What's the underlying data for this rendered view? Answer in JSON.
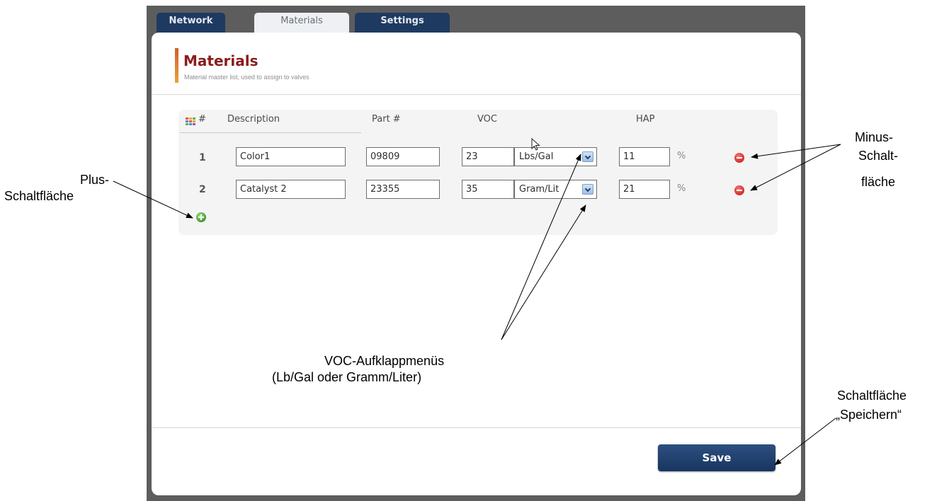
{
  "tabs": [
    {
      "label": "Network",
      "active": false
    },
    {
      "label": "Materials",
      "active": true
    },
    {
      "label": "Settings",
      "active": false
    }
  ],
  "page": {
    "title": "Materials",
    "subtitle": "Material master list, used to assign to valves"
  },
  "table": {
    "headers": {
      "number": "#",
      "description": "Description",
      "part": "Part #",
      "voc": "VOC",
      "hap": "HAP"
    },
    "rows": [
      {
        "num": "1",
        "description": "Color1",
        "part": "09809",
        "voc": "23",
        "voc_unit": "Lbs/Gal",
        "hap": "11",
        "hap_unit": "%"
      },
      {
        "num": "2",
        "description": "Catalyst 2",
        "part": "23355",
        "voc": "35",
        "voc_unit": "Gram/Lit",
        "hap": "21",
        "hap_unit": "%"
      }
    ]
  },
  "save_label": "Save",
  "annotations": {
    "plus_line1": "Plus-",
    "plus_line2": "Schaltfläche",
    "minus_line1": "Minus-",
    "minus_line2": "Schalt-",
    "minus_line3": "fläche",
    "voc_line1": "VOC-Aufklappmenüs",
    "voc_line2": "(Lb/Gal oder Gramm/Liter)",
    "save_line1": "Schaltfläche",
    "save_line2": "„Speichern“"
  },
  "colors": {
    "tab_dark": "#1f3a61",
    "title_red": "#8b1c1c",
    "minus_red": "#cf2a2a",
    "plus_green": "#3f9a2c",
    "save_blue": "#173560"
  },
  "icons": [
    "grid-icon",
    "minus-circle-icon",
    "plus-circle-icon",
    "dropdown-arrow-icon",
    "mouse-cursor-icon"
  ]
}
